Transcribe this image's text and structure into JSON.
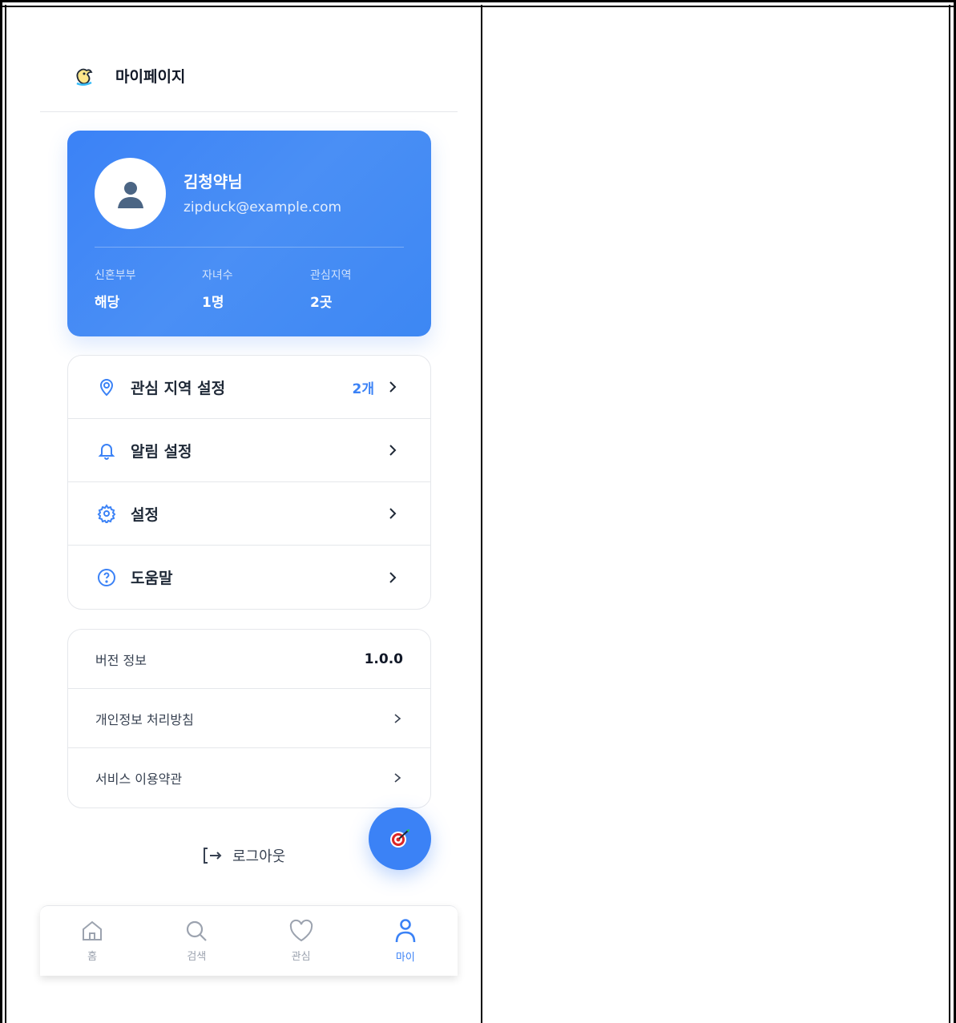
{
  "header": {
    "title": "마이페이지",
    "logo_icon": "duck-logo-icon"
  },
  "profile": {
    "name": "김청약님",
    "email": "zipduck@example.com",
    "stats": [
      {
        "label": "신혼부부",
        "value": "해당"
      },
      {
        "label": "자녀수",
        "value": "1명"
      },
      {
        "label": "관심지역",
        "value": "2곳"
      }
    ],
    "gradient_color": "#3b82f6"
  },
  "menu": [
    {
      "icon": "location-pin-icon",
      "label": "관심 지역 설정",
      "count": "2개"
    },
    {
      "icon": "bell-icon",
      "label": "알림 설정",
      "count": ""
    },
    {
      "icon": "gear-icon",
      "label": "설정",
      "count": ""
    },
    {
      "icon": "help-circle-icon",
      "label": "도움말",
      "count": ""
    }
  ],
  "info": {
    "version_label": "버전 정보",
    "version_value": "1.0.0",
    "privacy_label": "개인정보 처리방침",
    "terms_label": "서비스 이용약관"
  },
  "logout_label": "로그아웃",
  "fab_icon": "target-dart-icon",
  "tabs": [
    {
      "icon": "home-icon",
      "label": "홈"
    },
    {
      "icon": "search-icon",
      "label": "검색"
    },
    {
      "icon": "heart-icon",
      "label": "관심"
    },
    {
      "icon": "user-icon",
      "label": "마이"
    }
  ],
  "colors": {
    "accent": "#3b82f6",
    "muted": "#9ca3af"
  }
}
